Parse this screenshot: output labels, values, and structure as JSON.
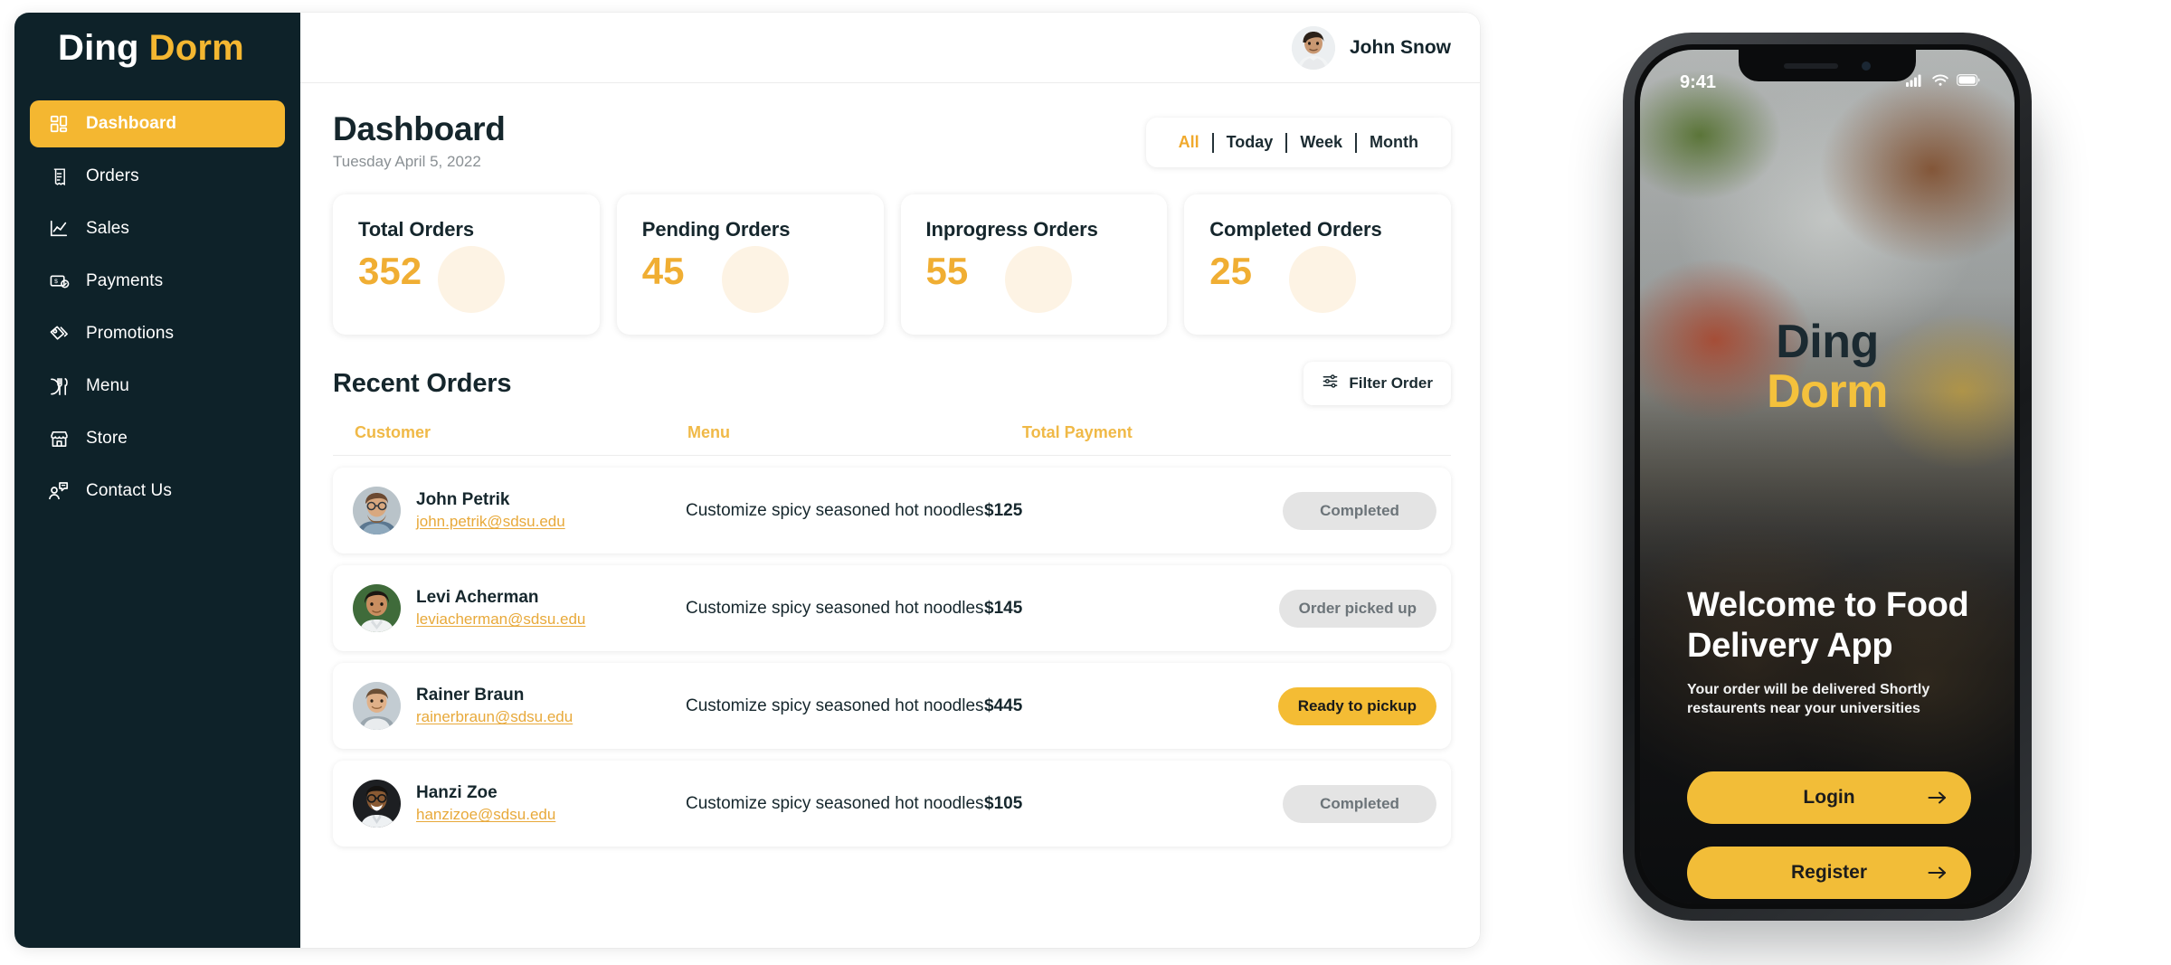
{
  "brand": {
    "part1": "Ding",
    "part2": "Dorm"
  },
  "sidebar": {
    "items": [
      {
        "label": "Dashboard",
        "icon": "grid-icon",
        "active": true
      },
      {
        "label": "Orders",
        "icon": "receipt-icon",
        "active": false
      },
      {
        "label": "Sales",
        "icon": "chart-icon",
        "active": false
      },
      {
        "label": "Payments",
        "icon": "payment-icon",
        "active": false
      },
      {
        "label": "Promotions",
        "icon": "tag-icon",
        "active": false
      },
      {
        "label": "Menu",
        "icon": "cutlery-icon",
        "active": false
      },
      {
        "label": "Store",
        "icon": "store-icon",
        "active": false
      },
      {
        "label": "Contact Us",
        "icon": "support-icon",
        "active": false
      }
    ]
  },
  "topbar": {
    "user_name": "John Snow",
    "avatar_icon": "avatar"
  },
  "page": {
    "title": "Dashboard",
    "date": "Tuesday April 5, 2022"
  },
  "range_tabs": [
    {
      "label": "All",
      "active": true
    },
    {
      "label": "Today",
      "active": false
    },
    {
      "label": "Week",
      "active": false
    },
    {
      "label": "Month",
      "active": false
    }
  ],
  "stats": [
    {
      "title": "Total Orders",
      "value": "352"
    },
    {
      "title": "Pending Orders",
      "value": "45"
    },
    {
      "title": "Inprogress Orders",
      "value": "55"
    },
    {
      "title": "Completed Orders",
      "value": "25"
    }
  ],
  "recent_orders": {
    "title": "Recent Orders",
    "filter_button": "Filter Order",
    "filter_icon": "sliders-icon",
    "columns": [
      "Customer",
      "Menu",
      "Total Payment"
    ],
    "rows": [
      {
        "name": "John Petrik",
        "email": "john.petrik@sdsu.edu",
        "menu": "Customize spicy seasoned hot noodles",
        "total": "$125",
        "status": "Completed",
        "status_style": "gray"
      },
      {
        "name": "Levi Acherman",
        "email": "leviacherman@sdsu.edu",
        "menu": "Customize spicy seasoned hot noodles",
        "total": "$145",
        "status": "Order picked up",
        "status_style": "gray"
      },
      {
        "name": "Rainer Braun",
        "email": "rainerbraun@sdsu.edu",
        "menu": "Customize spicy seasoned hot noodles",
        "total": "$445",
        "status": "Ready to pickup",
        "status_style": "yellow"
      },
      {
        "name": "Hanzi Zoe",
        "email": "hanzizoe@sdsu.edu",
        "menu": "Customize spicy seasoned hot noodles",
        "total": "$105",
        "status": "Completed",
        "status_style": "gray"
      }
    ]
  },
  "phone": {
    "status_time": "9:41",
    "status_icons": [
      "signal-icon",
      "wifi-icon",
      "battery-icon"
    ],
    "logo_line1": "Ding",
    "logo_line2": "Dorm",
    "heading": "Welcome to Food Delivery App",
    "subheading": "Your order will be delivered Shortly restaurents near your universities",
    "buttons": [
      {
        "label": "Login",
        "icon": "arrow-right-icon"
      },
      {
        "label": "Register",
        "icon": "arrow-right-icon"
      }
    ]
  },
  "colors": {
    "sidebar_bg": "#0e2229",
    "accent_yellow": "#f4b731",
    "stat_value": "#f0ae33",
    "header_orange": "#f0b947",
    "badge_gray_bg": "#e4e4e4",
    "badge_yellow_bg": "#f4bc34",
    "text_dark": "#15262c"
  }
}
